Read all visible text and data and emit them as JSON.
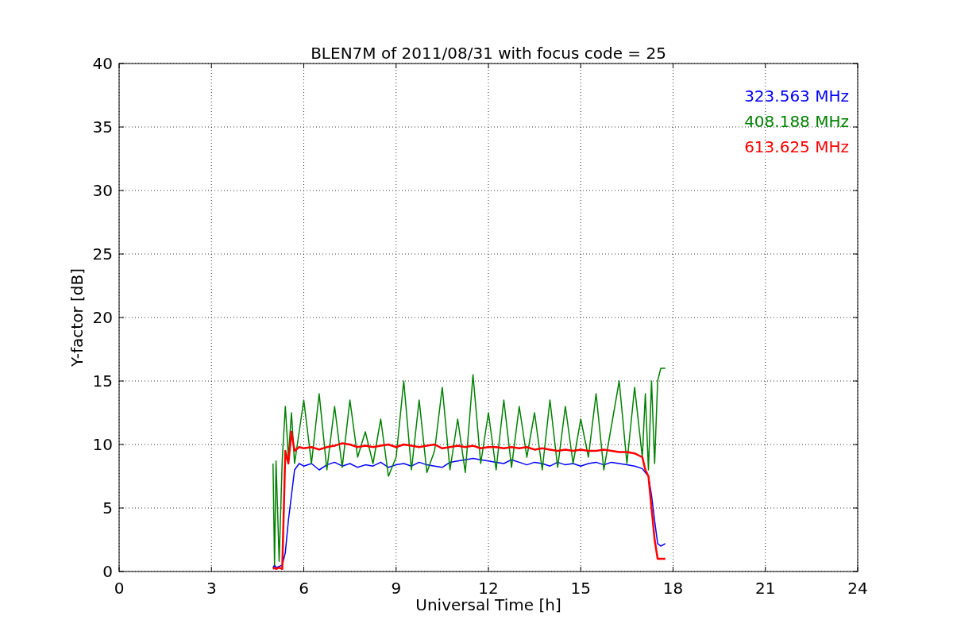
{
  "figure": {
    "chart_data": {
      "type": "line",
      "title": "BLEN7M of 2011/08/31 with focus code = 25",
      "xlabel": "Universal Time [h]",
      "ylabel": "Y-factor [dB]",
      "x": [
        5.0,
        5.05,
        5.1,
        5.2,
        5.3,
        5.4,
        5.5,
        5.6,
        5.7,
        5.85,
        6.0,
        6.25,
        6.5,
        6.75,
        7.0,
        7.25,
        7.5,
        7.75,
        8.0,
        8.25,
        8.5,
        8.75,
        9.0,
        9.25,
        9.5,
        9.75,
        10.0,
        10.25,
        10.5,
        10.75,
        11.0,
        11.25,
        11.5,
        11.75,
        12.0,
        12.25,
        12.5,
        12.75,
        13.0,
        13.25,
        13.5,
        13.75,
        14.0,
        14.25,
        14.5,
        14.75,
        15.0,
        15.25,
        15.5,
        15.75,
        16.0,
        16.25,
        16.5,
        16.75,
        17.0,
        17.1,
        17.2,
        17.3,
        17.4,
        17.5,
        17.6,
        17.75
      ],
      "series": [
        {
          "name": "323.563 MHz",
          "color": "#0000ff",
          "values": [
            0.3,
            0.5,
            0.3,
            0.4,
            0.5,
            1.5,
            4,
            6,
            8,
            8.5,
            8.3,
            8.5,
            8.0,
            8.4,
            8.6,
            8.3,
            8.5,
            8.2,
            8.4,
            8.3,
            8.6,
            8.2,
            8.4,
            8.5,
            8.3,
            8.6,
            8.4,
            8.3,
            8.2,
            8.6,
            8.7,
            8.8,
            8.9,
            8.8,
            8.7,
            8.6,
            8.5,
            8.8,
            8.6,
            8.4,
            8.6,
            8.5,
            8.3,
            8.6,
            8.4,
            8.5,
            8.3,
            8.5,
            8.6,
            8.4,
            8.6,
            8.5,
            8.4,
            8.3,
            8.1,
            7.8,
            7.5,
            6.0,
            4.0,
            2.2,
            2.0,
            2.2
          ]
        },
        {
          "name": "408.188 MHz",
          "color": "#008000",
          "values": [
            8.5,
            0.5,
            8.7,
            0.8,
            8.8,
            13.0,
            9.0,
            12.5,
            8.5,
            11.0,
            13.5,
            8.5,
            14.0,
            8.0,
            13.0,
            8.2,
            13.5,
            9.0,
            11.0,
            8.5,
            12.0,
            7.5,
            9.0,
            15.0,
            8.0,
            13.5,
            7.8,
            9.5,
            14.5,
            8.0,
            12.0,
            7.8,
            15.5,
            8.5,
            12.5,
            8.0,
            13.5,
            8.2,
            13.0,
            9.0,
            12.5,
            8.0,
            13.5,
            8.2,
            13.0,
            8.5,
            12.0,
            9.0,
            14.0,
            8.0,
            11.5,
            15.0,
            8.5,
            14.5,
            9.0,
            14.0,
            8.0,
            15.0,
            8.5,
            15.0,
            16.0,
            16.0
          ]
        },
        {
          "name": "613.625 MHz",
          "color": "#ff0000",
          "values": [
            0.2,
            0.3,
            0.2,
            0.3,
            0.2,
            9.5,
            8.5,
            11.0,
            9.5,
            9.8,
            9.7,
            9.8,
            9.6,
            9.8,
            9.9,
            10.1,
            10.0,
            9.8,
            9.9,
            9.8,
            9.9,
            10.0,
            9.8,
            10.0,
            9.9,
            9.8,
            9.9,
            10.0,
            9.7,
            9.8,
            9.9,
            9.8,
            9.9,
            9.7,
            9.8,
            9.8,
            9.7,
            9.8,
            9.7,
            9.8,
            9.6,
            9.7,
            9.6,
            9.5,
            9.6,
            9.5,
            9.6,
            9.5,
            9.5,
            9.6,
            9.5,
            9.4,
            9.4,
            9.3,
            9.0,
            8.0,
            7.5,
            5.0,
            2.5,
            1.0,
            1.0,
            1.0
          ]
        }
      ],
      "grid": true,
      "xlim": [
        0,
        24
      ],
      "ylim": [
        0,
        40
      ],
      "xticks": [
        0,
        3,
        6,
        9,
        12,
        15,
        18,
        21,
        24
      ],
      "yticks": [
        0,
        5,
        10,
        15,
        20,
        25,
        30,
        35,
        40
      ]
    }
  }
}
